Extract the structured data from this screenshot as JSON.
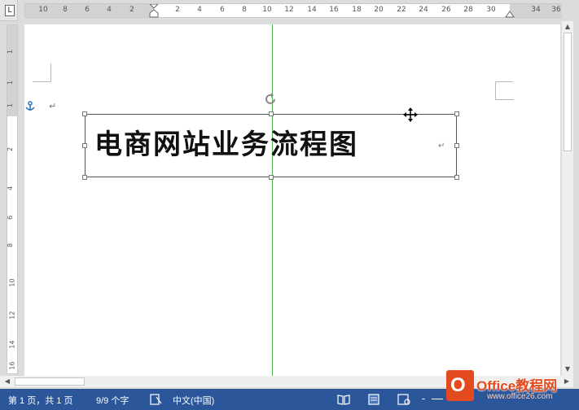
{
  "ruler": {
    "corner_label": "L",
    "h_numbers": [
      "10",
      "8",
      "6",
      "4",
      "2",
      "2",
      "4",
      "6",
      "8",
      "10",
      "12",
      "14",
      "16",
      "18",
      "20",
      "22",
      "24",
      "26",
      "28",
      "30",
      "34",
      "36"
    ],
    "v_numbers": [
      "1",
      "1",
      "1",
      "2",
      "4",
      "6",
      "8",
      "10",
      "12",
      "14",
      "16"
    ]
  },
  "document": {
    "title_text": "电商网站业务流程图",
    "paragraph_mark": "↵",
    "anchor_icon": "anchor-icon"
  },
  "status_bar": {
    "page_info": "第 1 页，共 1 页",
    "word_count": "9/9 个字",
    "language": "中文(中国)",
    "zoom_minus": "-"
  },
  "watermark": {
    "brand_name": "Office教程网",
    "url": "www.office26.com"
  },
  "colors": {
    "status_bar": "#2b579a",
    "guide_line": "#52b052",
    "logo": "#e34b1e"
  }
}
